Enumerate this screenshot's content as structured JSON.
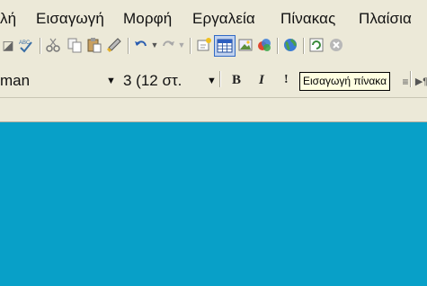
{
  "menubar": {
    "items": [
      {
        "label": "λή"
      },
      {
        "label": "Εισαγωγή"
      },
      {
        "label": "Μορφή"
      },
      {
        "label": "Εργαλεία"
      },
      {
        "label": "Πίνακας"
      },
      {
        "label": "Πλαίσια"
      }
    ]
  },
  "formatting": {
    "font_name": "man",
    "font_size": "3 (12 στ.",
    "bold_label": "B",
    "italic_label": "I"
  },
  "tooltip": {
    "text": "Εισαγωγή πίνακα"
  },
  "icons": {
    "spellcheck": "spellcheck-icon",
    "cut": "cut-icon",
    "copy": "copy-icon",
    "paste": "paste-icon",
    "format_painter": "format-painter-icon",
    "undo": "undo-icon",
    "redo": "redo-icon",
    "insert_table": "insert-table-icon",
    "insert_picture": "insert-picture-icon"
  },
  "colors": {
    "canvas": "#08a0c8",
    "chrome": "#ece9d8",
    "tooltip_bg": "#ffffe1"
  }
}
